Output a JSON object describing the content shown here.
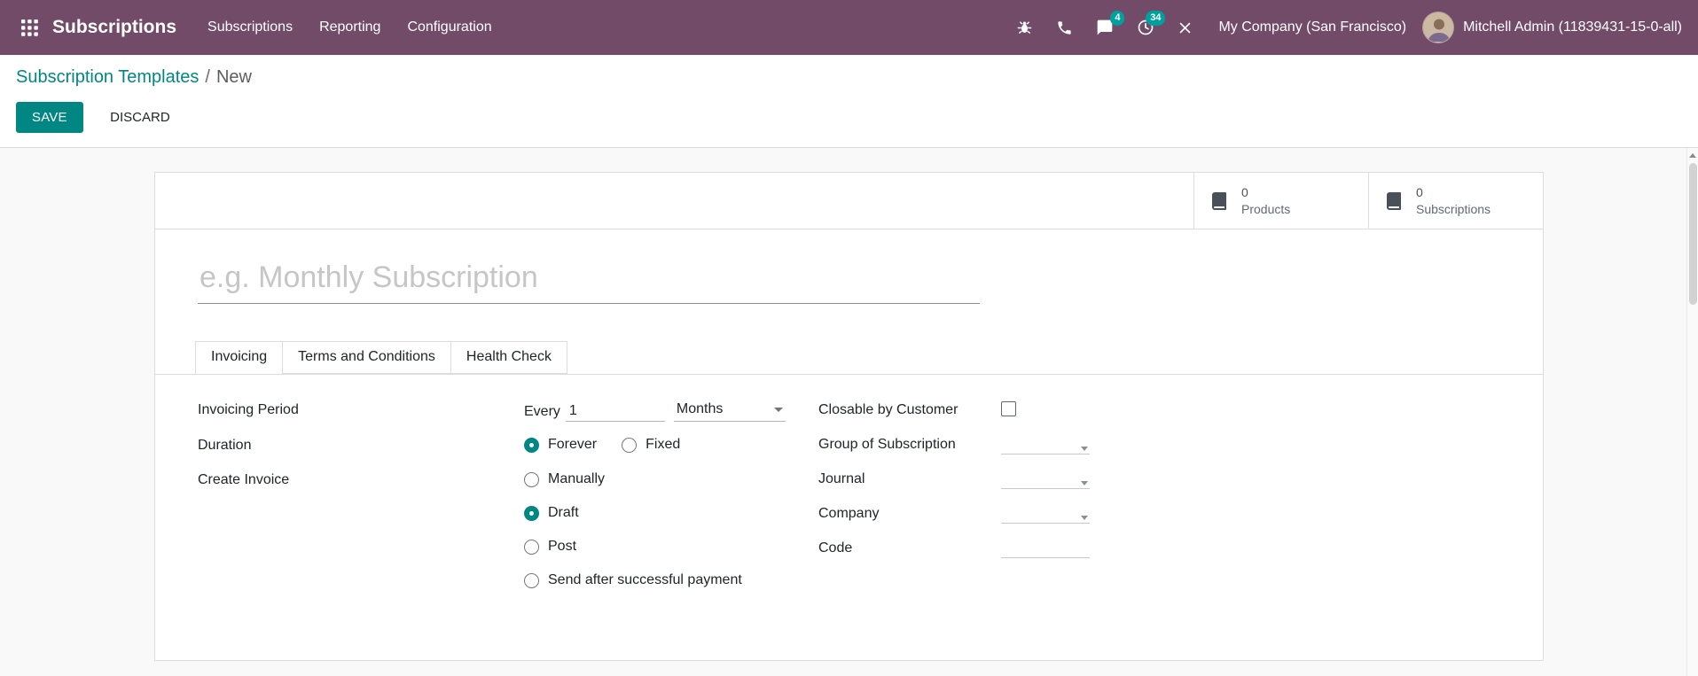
{
  "navbar": {
    "app_title": "Subscriptions",
    "menu_items": [
      "Subscriptions",
      "Reporting",
      "Configuration"
    ],
    "badges": {
      "messages": "4",
      "activities": "34"
    },
    "company": "My Company (San Francisco)",
    "user": "Mitchell Admin (11839431-15-0-all)"
  },
  "breadcrumb": {
    "root": "Subscription Templates",
    "separator": "/",
    "current": "New"
  },
  "control_panel": {
    "save_label": "SAVE",
    "discard_label": "DISCARD"
  },
  "stat_buttons": [
    {
      "value": "0",
      "label": "Products"
    },
    {
      "value": "0",
      "label": "Subscriptions"
    }
  ],
  "form": {
    "name_placeholder": "e.g. Monthly Subscription",
    "tabs": [
      {
        "label": "Invoicing",
        "active": true
      },
      {
        "label": "Terms and Conditions",
        "active": false
      },
      {
        "label": "Health Check",
        "active": false
      }
    ],
    "invoicing_period": {
      "label": "Invoicing Period",
      "prefix": "Every",
      "value": "1",
      "unit": "Months"
    },
    "duration": {
      "label": "Duration",
      "options": [
        {
          "label": "Forever",
          "checked": true
        },
        {
          "label": "Fixed",
          "checked": false
        }
      ]
    },
    "create_invoice": {
      "label": "Create Invoice",
      "options": [
        {
          "label": "Manually",
          "checked": false
        },
        {
          "label": "Draft",
          "checked": true
        },
        {
          "label": "Post",
          "checked": false
        },
        {
          "label": "Send after successful payment",
          "checked": false
        }
      ]
    },
    "closable": {
      "label": "Closable by Customer",
      "checked": false
    },
    "group_of_subscription": {
      "label": "Group of Subscription",
      "value": ""
    },
    "journal": {
      "label": "Journal",
      "value": ""
    },
    "company": {
      "label": "Company",
      "value": ""
    },
    "code": {
      "label": "Code",
      "value": ""
    }
  },
  "colors": {
    "navbar_bg": "#714B67",
    "accent": "#008784",
    "badge": "#00A09D"
  }
}
